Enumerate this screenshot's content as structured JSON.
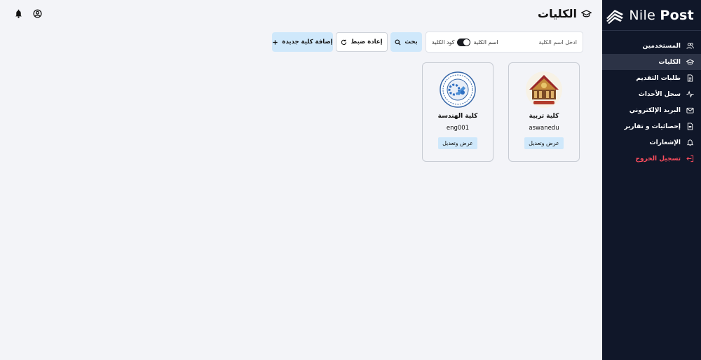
{
  "brand": {
    "name_light": "Nile",
    "name_bold": "Post"
  },
  "header": {
    "title": "الكليات",
    "title_icon": "graduation-cap-icon"
  },
  "topbar": {
    "icons": [
      "bell-icon",
      "user-circle-icon"
    ]
  },
  "sidebar": {
    "items": [
      {
        "label": "المستخدمين",
        "icon": "users-icon"
      },
      {
        "label": "الكليات",
        "icon": "graduation-cap-icon",
        "active": true
      },
      {
        "label": "طلبات التقديم",
        "icon": "document-icon"
      },
      {
        "label": "سجل الأحداث",
        "icon": "activity-icon"
      },
      {
        "label": "البريد الإلكتروني",
        "icon": "mail-icon"
      },
      {
        "label": "إحصائيات و تقارير",
        "icon": "report-icon"
      },
      {
        "label": "الإشعارات",
        "icon": "bell-icon"
      },
      {
        "label": "تسجيل الخروج",
        "icon": "logout-icon",
        "color": "#ff4d5e"
      }
    ]
  },
  "search": {
    "placeholder": "ادخل اسم الكلية",
    "toggle_left_label": "كود الكلية",
    "toggle_right_label": "اسم الكلية",
    "search_button": "بحث",
    "reset_button": "إعادة ضبط",
    "add_button": "إضافة كلية جديدة"
  },
  "faculties": [
    {
      "name": "كلية تربية",
      "code": "aswanedu",
      "action": "عرض وتعديل"
    },
    {
      "name": "كلية الهندسة",
      "code": "eng001",
      "action": "عرض وتعديل"
    }
  ],
  "colors": {
    "sidebar_bg": "#101729",
    "accent": "#cfe8fb",
    "logout": "#ff4d5e",
    "page_bg": "#f3f4f8"
  }
}
